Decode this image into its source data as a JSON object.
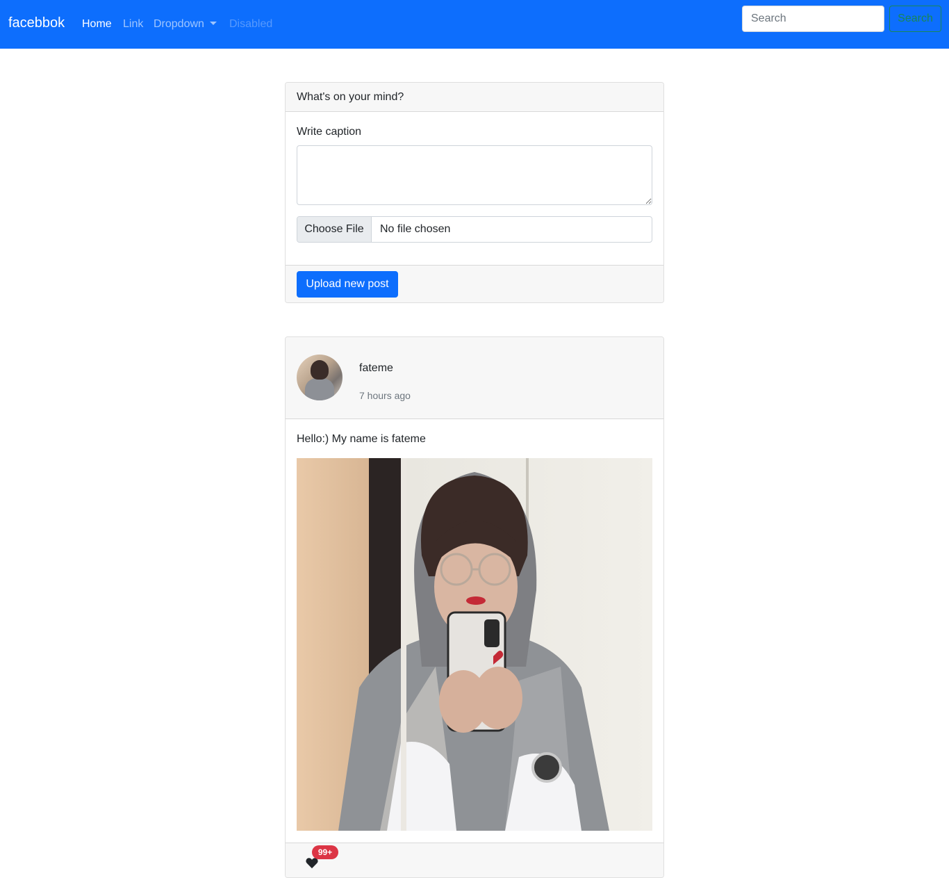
{
  "navbar": {
    "brand": "facebbok",
    "links": [
      {
        "label": "Home"
      },
      {
        "label": "Link"
      },
      {
        "label": "Dropdown"
      },
      {
        "label": "Disabled"
      }
    ],
    "search": {
      "placeholder": "Search",
      "button_label": "Search"
    },
    "colors": {
      "background": "#0d6efd",
      "search_button": "#198754"
    }
  },
  "upload_card": {
    "header": "What's on your mind?",
    "caption_label": "Write caption",
    "caption_value": "",
    "file_button": "Choose File",
    "file_status": "No file chosen",
    "submit_label": "Upload new post"
  },
  "post": {
    "author": "fateme",
    "time_ago": "7 hours ago",
    "caption": "Hello:) My name is fateme",
    "like_icon": "heart-icon",
    "like_count": "99+",
    "colors": {
      "badge": "#dc3545"
    }
  }
}
